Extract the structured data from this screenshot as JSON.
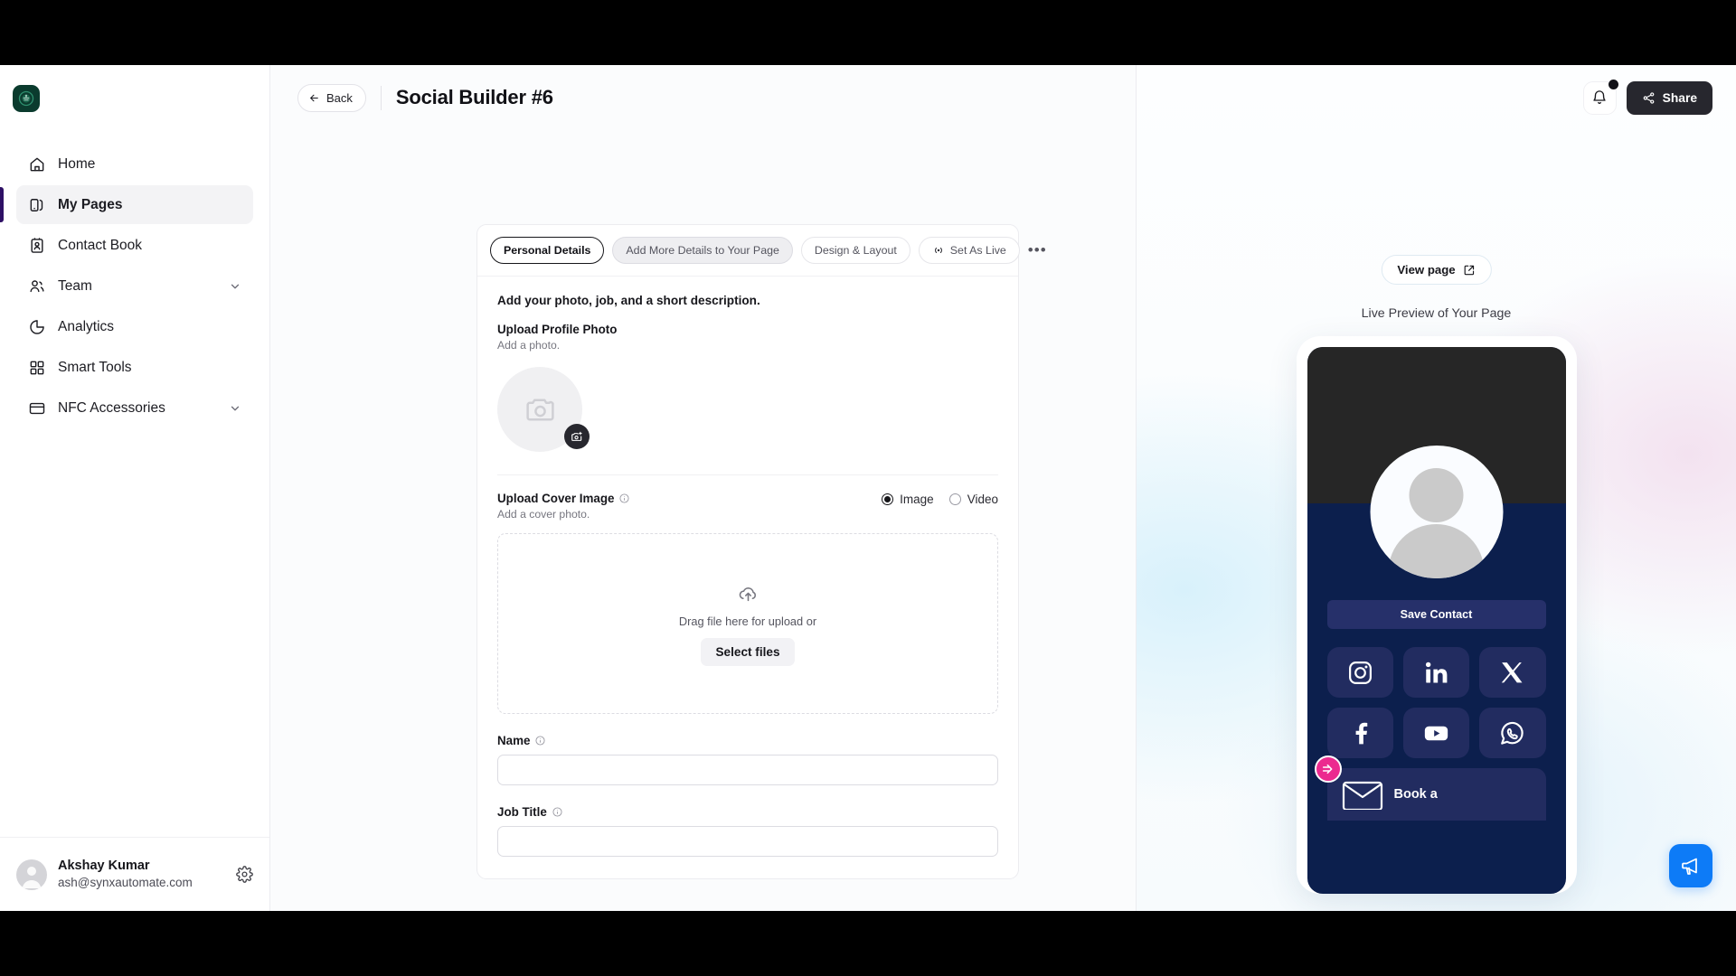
{
  "sidebar": {
    "logo_name": "starbucks-logo",
    "items": [
      {
        "label": "Home",
        "icon": "home-icon",
        "expandable": false,
        "active": false
      },
      {
        "label": "My Pages",
        "icon": "pages-icon",
        "expandable": false,
        "active": true
      },
      {
        "label": "Contact Book",
        "icon": "contact-book-icon",
        "expandable": false,
        "active": false
      },
      {
        "label": "Team",
        "icon": "team-icon",
        "expandable": true,
        "active": false
      },
      {
        "label": "Analytics",
        "icon": "analytics-icon",
        "expandable": false,
        "active": false
      },
      {
        "label": "Smart Tools",
        "icon": "smart-tools-icon",
        "expandable": false,
        "active": false
      },
      {
        "label": "NFC Accessories",
        "icon": "nfc-card-icon",
        "expandable": true,
        "active": false
      }
    ],
    "user": {
      "name": "Akshay Kumar",
      "email": "ash@synxautomate.com",
      "settings_icon": "gear-icon"
    }
  },
  "topbar": {
    "back_label": "Back",
    "page_title": "Social Builder #6"
  },
  "header_actions": {
    "share_label": "Share",
    "notification_icon": "bell-icon",
    "has_notification": true
  },
  "tabs": [
    {
      "label": "Personal Details",
      "state": "active"
    },
    {
      "label": "Add More Details to Your Page",
      "state": "muted"
    },
    {
      "label": "Design & Layout",
      "state": "default"
    }
  ],
  "tab_actions": {
    "set_as_live_label": "Set As Live",
    "overflow_label": "•••"
  },
  "form": {
    "section_heading": "Add your photo, job, and a short description.",
    "profile_photo": {
      "label": "Upload Profile Photo",
      "sub": "Add a photo."
    },
    "cover_image": {
      "label": "Upload Cover Image",
      "sub": "Add a cover photo.",
      "options": [
        {
          "label": "Image",
          "selected": true
        },
        {
          "label": "Video",
          "selected": false
        }
      ],
      "dropzone_text": "Drag file here for upload or",
      "select_files_label": "Select files"
    },
    "fields": [
      {
        "label": "Name",
        "value": "",
        "placeholder": ""
      },
      {
        "label": "Job Title",
        "value": "",
        "placeholder": ""
      }
    ]
  },
  "preview": {
    "view_page_label": "View page",
    "caption": "Live Preview of Your Page",
    "save_contact_label": "Save Contact",
    "social_links": [
      {
        "name": "instagram-icon"
      },
      {
        "name": "linkedin-icon"
      },
      {
        "name": "x-twitter-icon"
      },
      {
        "name": "facebook-icon"
      },
      {
        "name": "youtube-icon"
      },
      {
        "name": "whatsapp-icon"
      }
    ],
    "book_label": "Book a",
    "badge_icon": "arrow-in-circle-icon"
  },
  "chat_widget": {
    "icon": "megaphone-icon"
  },
  "colors": {
    "accent_dark": "#27272e",
    "sidebar_active_bar": "#2e1065",
    "phone_bg": "#0c1f4d",
    "social_tile": "#222c60",
    "pink_badge": "#ec2a8f",
    "chat_blue": "#0d7bf7",
    "logo_green": "#0b3b2e"
  }
}
